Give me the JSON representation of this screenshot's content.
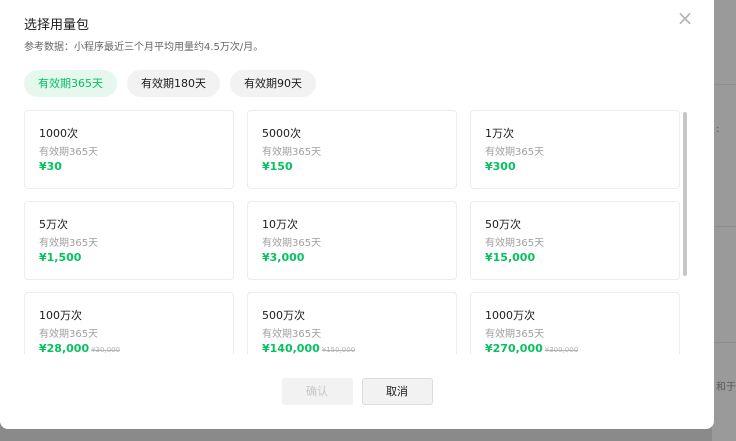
{
  "dialog": {
    "title": "选择用量包",
    "subtitle": "参考数据：小程序最近三个月平均用量约4.5万次/月。",
    "close_icon": "×"
  },
  "tabs": [
    {
      "label": "有效期365天",
      "active": true
    },
    {
      "label": "有效期180天",
      "active": false
    },
    {
      "label": "有效期90天",
      "active": false
    }
  ],
  "packages": [
    {
      "name": "1000次",
      "validity": "有效期365天",
      "price": "¥30",
      "original": ""
    },
    {
      "name": "5000次",
      "validity": "有效期365天",
      "price": "¥150",
      "original": ""
    },
    {
      "name": "1万次",
      "validity": "有效期365天",
      "price": "¥300",
      "original": ""
    },
    {
      "name": "5万次",
      "validity": "有效期365天",
      "price": "¥1,500",
      "original": ""
    },
    {
      "name": "10万次",
      "validity": "有效期365天",
      "price": "¥3,000",
      "original": ""
    },
    {
      "name": "50万次",
      "validity": "有效期365天",
      "price": "¥15,000",
      "original": ""
    },
    {
      "name": "100万次",
      "validity": "有效期365天",
      "price": "¥28,000",
      "original": "¥30,000"
    },
    {
      "name": "500万次",
      "validity": "有效期365天",
      "price": "¥140,000",
      "original": "¥150,000"
    },
    {
      "name": "1000万次",
      "validity": "有效期365天",
      "price": "¥270,000",
      "original": "¥300,000"
    }
  ],
  "buttons": {
    "confirm": "确认",
    "cancel": "取消"
  },
  "background": {
    "fragment_1": ":",
    "fragment_2": "和于"
  },
  "colors": {
    "accent": "#07c160",
    "accent_bg": "#e6f7ee"
  }
}
